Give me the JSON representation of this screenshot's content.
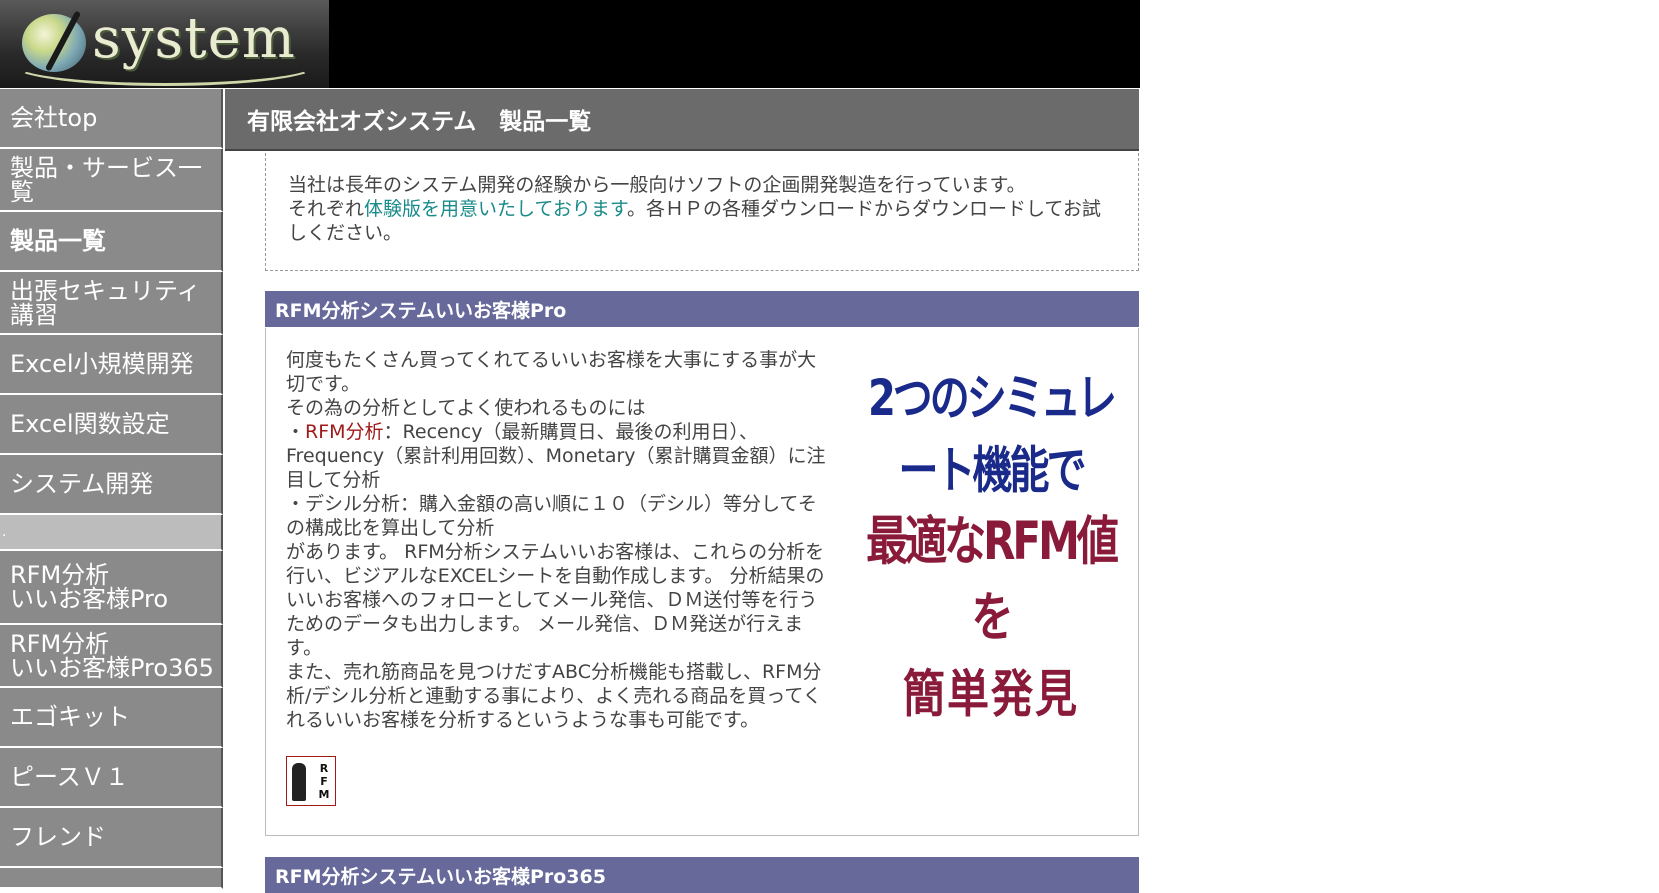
{
  "logo": {
    "text": "system"
  },
  "sidebar": {
    "items": [
      {
        "label": "会社top"
      },
      {
        "label": "製品・サービス一覧"
      },
      {
        "label": "製品一覧"
      },
      {
        "label": "出張セキュリティ講習"
      },
      {
        "label": "Excel小規模開発"
      },
      {
        "label": "Excel関数設定"
      },
      {
        "label": "システム開発"
      },
      {
        "label": "."
      },
      {
        "label": "RFM分析\nいいお客様Pro"
      },
      {
        "label": "RFM分析\nいいお客様Pro365"
      },
      {
        "label": "エゴキット"
      },
      {
        "label": "ピースＶ１"
      },
      {
        "label": "フレンド"
      }
    ]
  },
  "main": {
    "title": "有限会社オズシステム　製品一覧",
    "intro": {
      "line1": "当社は長年のシステム開発の経験から一般向けソフトの企画開発製造を行っています。",
      "line2_pre": "それぞれ",
      "line2_link": "体験版を用意いたしております",
      "line2_post": "。各ＨＰの各種ダウンロードからダウンロードしてお試しください。"
    },
    "products": [
      {
        "heading": "RFM分析システムいいお客様Pro",
        "p1": "何度もたくさん買ってくれてるいいお客様を大事にする事が大切です。",
        "p2": "その為の分析としてよく使われるものには",
        "p3_pre": "・",
        "p3_link": "RFM分析",
        "p3_post": "：Recency（最新購買日、最後の利用日）、Frequency（累計利用回数）、Monetary（累計購買金額）に注目して分析",
        "p4": "・デシル分析：購入金額の高い順に１０（デシル）等分してその構成比を算出して分析",
        "p5": "があります。 RFM分析システムいいお客様は、これらの分析を行い、ビジアルなEXCELシートを自動作成します。 分析結果のいいお客様へのフォローとしてメール発信、ＤＭ送付等を行うためのデータも出力します。 メール発信、ＤＭ発送が行えます。",
        "p6": "また、売れ筋商品を見つけだすABC分析機能も搭載し、RFM分析/デシル分析と連動する事により、よく売れる商品を買ってくれるいいお客様を分析するというような事も可能です。",
        "promo": [
          "2つのシミュレート機能で",
          "最適なRFM値を",
          "簡単発見"
        ],
        "icon_letters": [
          "R",
          "F",
          "M"
        ]
      },
      {
        "heading": "RFM分析システムいいお客様Pro365"
      }
    ]
  },
  "colors": {
    "sidebar_bg": "#8a8a8a",
    "title_bar_bg": "#6b6b6b",
    "section_head_bg": "#66699a",
    "link_teal": "#1a8a8a",
    "link_red": "#a01a1a",
    "promo_blue": "#1a2a8a",
    "promo_red": "#8a1a3a"
  }
}
